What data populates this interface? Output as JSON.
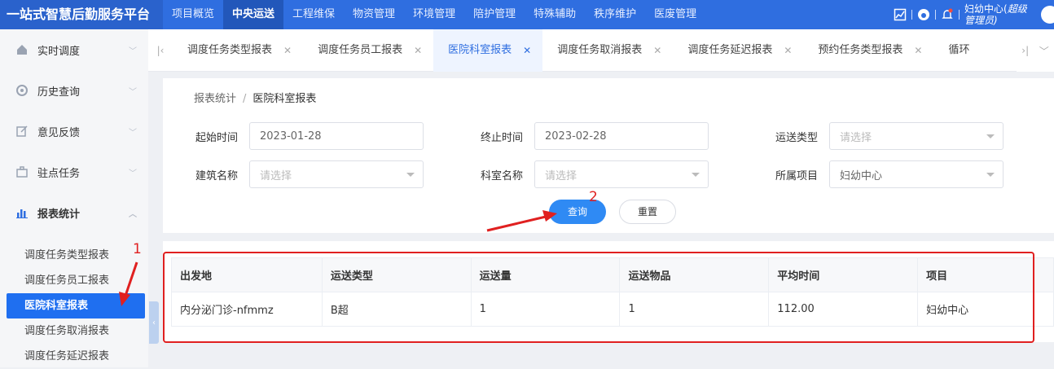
{
  "app": {
    "title": "一站式智慧后勤服务平台"
  },
  "topnav": [
    {
      "label": "项目概览",
      "active": false
    },
    {
      "label": "中央运送",
      "active": true
    },
    {
      "label": "工程维保",
      "active": false
    },
    {
      "label": "物资管理",
      "active": false
    },
    {
      "label": "环境管理",
      "active": false
    },
    {
      "label": "陪护管理",
      "active": false
    },
    {
      "label": "特殊辅助",
      "active": false
    },
    {
      "label": "秩序维护",
      "active": false
    },
    {
      "label": "医废管理",
      "active": false
    }
  ],
  "user": {
    "org": "妇幼中心(",
    "role": "超级管理员)"
  },
  "sidebar": {
    "items": [
      {
        "label": "实时调度",
        "icon": "home-icon"
      },
      {
        "label": "历史查询",
        "icon": "history-icon"
      },
      {
        "label": "意见反馈",
        "icon": "edit-icon"
      },
      {
        "label": "驻点任务",
        "icon": "briefcase-icon"
      },
      {
        "label": "报表统计",
        "icon": "bar-chart-icon"
      }
    ],
    "subitems": [
      {
        "label": "调度任务类型报表",
        "active": false
      },
      {
        "label": "调度任务员工报表",
        "active": false
      },
      {
        "label": "医院科室报表",
        "active": true
      },
      {
        "label": "调度任务取消报表",
        "active": false
      },
      {
        "label": "调度任务延迟报表",
        "active": false
      }
    ]
  },
  "tabs": [
    {
      "label": "调度任务类型报表",
      "active": false
    },
    {
      "label": "调度任务员工报表",
      "active": false
    },
    {
      "label": "医院科室报表",
      "active": true
    },
    {
      "label": "调度任务取消报表",
      "active": false
    },
    {
      "label": "调度任务延迟报表",
      "active": false
    },
    {
      "label": "预约任务类型报表",
      "active": false
    },
    {
      "label": "循环",
      "active": false
    }
  ],
  "breadcrumb": {
    "root": "报表统计",
    "current": "医院科室报表"
  },
  "filters": {
    "start_label": "起始时间",
    "start_value": "2023-01-28",
    "end_label": "终止时间",
    "end_value": "2023-02-28",
    "type_label": "运送类型",
    "type_placeholder": "请选择",
    "building_label": "建筑名称",
    "building_placeholder": "请选择",
    "dept_label": "科室名称",
    "dept_placeholder": "请选择",
    "project_label": "所属项目",
    "project_value": "妇幼中心"
  },
  "buttons": {
    "query": "查询",
    "reset": "重置"
  },
  "table": {
    "headers": [
      "出发地",
      "运送类型",
      "运送量",
      "运送物品",
      "平均时间",
      "项目"
    ],
    "rows": [
      [
        "内分泌门诊-nfmmz",
        "B超",
        "1",
        "1",
        "112.00",
        "妇幼中心"
      ]
    ]
  },
  "annotations": {
    "one": "1",
    "two": "2"
  }
}
